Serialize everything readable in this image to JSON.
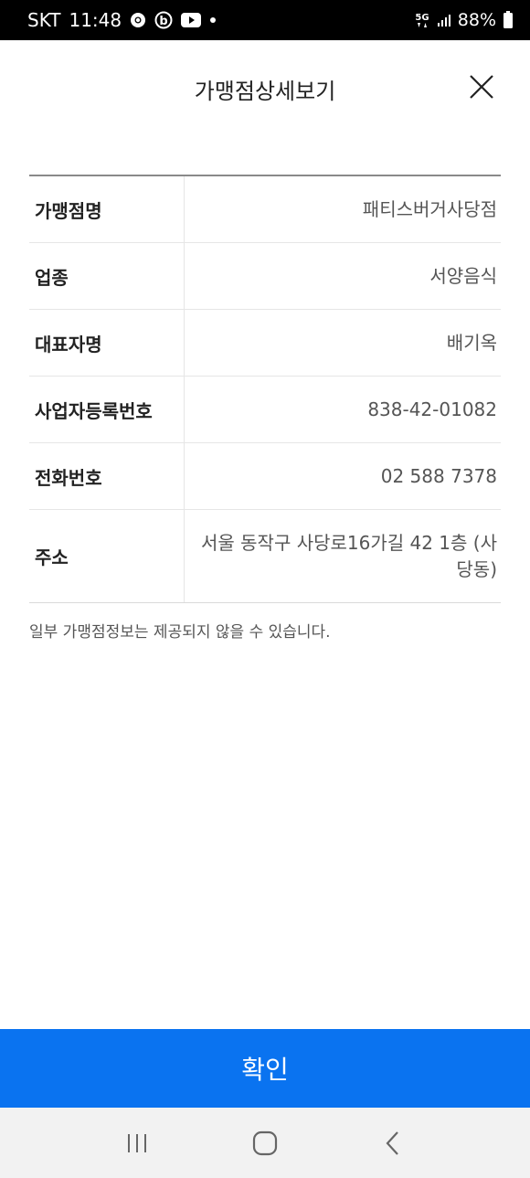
{
  "status_bar": {
    "carrier": "SKT",
    "time": "11:48",
    "network": "5G",
    "battery": "88%",
    "icons": [
      "chrome-icon",
      "b-app-icon",
      "youtube-icon",
      "dot-icon",
      "5g-icon",
      "signal-icon",
      "battery-icon"
    ]
  },
  "header": {
    "title": "가맹점상세보기",
    "close_icon": "close-icon"
  },
  "merchant_info": [
    {
      "label": "가맹점명",
      "value": "패티스버거사당점"
    },
    {
      "label": "업종",
      "value": "서양음식"
    },
    {
      "label": "대표자명",
      "value": "배기옥"
    },
    {
      "label": "사업자등록번호",
      "value": "838-42-01082"
    },
    {
      "label": "전화번호",
      "value": "02 588 7378"
    },
    {
      "label": "주소",
      "value": "서울 동작구 사당로16가길 42 1층 (사당동)"
    }
  ],
  "notice": "일부 가맹점정보는 제공되지 않을 수 있습니다.",
  "confirm_label": "확인",
  "nav": {
    "recent_icon": "recent-apps-icon",
    "home_icon": "home-icon",
    "back_icon": "back-icon"
  },
  "colors": {
    "primary": "#0a73f0",
    "status_bar": "#000000",
    "nav_bar": "#f2f2f2"
  }
}
